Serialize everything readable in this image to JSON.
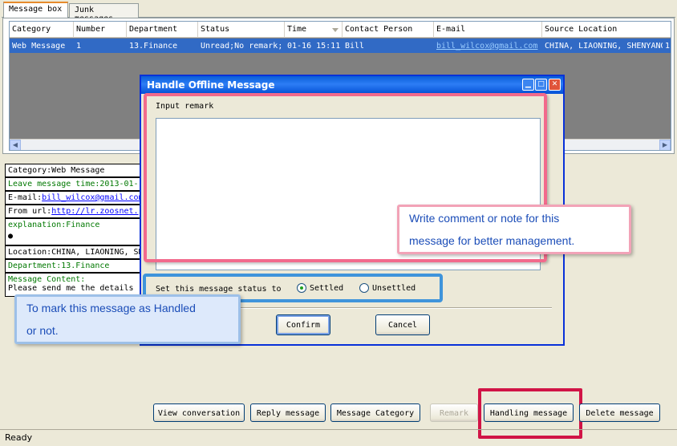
{
  "tabs": [
    {
      "label": "Message box",
      "active": true
    },
    {
      "label": "Junk messages",
      "active": false
    }
  ],
  "table": {
    "columns": [
      "Category",
      "Number",
      "Department",
      "Status",
      "Time",
      "Contact Person",
      "E-mail",
      "Source Location"
    ],
    "rows": [
      [
        "Web Message",
        "1",
        "13.Finance",
        "Unread;No remark;",
        "01-16 15:11",
        "Bill",
        "bill_wilcox@gmail.com",
        "CHINA, LIAONING, SHENYANG",
        "1"
      ]
    ]
  },
  "details": {
    "category": "Category:Web Message",
    "leave_time": "Leave message time:2013-01-",
    "email_prefix": "E-mail:",
    "email_value": "bill_wilcox@gmail.com",
    "from_url_prefix": "From url:",
    "from_url_value": "http://lr.zoosnet.",
    "explanation": "explanation:Finance",
    "bullet": "●",
    "location": "Location:CHINA, LIAONING, SHE",
    "department": "Department:13.Finance",
    "content_label": "Message Content:",
    "content_text": "Please send me the details"
  },
  "dialog": {
    "title": "Handle Offline Message",
    "remark_label": "Input remark",
    "remark_value": "",
    "status_label": "Set this message status to",
    "option_settled": "Settled",
    "option_unsettled": "Unsettled",
    "selected": "Settled",
    "confirm": "Confirm",
    "cancel": "Cancel"
  },
  "callouts": {
    "remark_note": [
      "Write comment or note for this",
      "message for better management."
    ],
    "status_note": [
      "To mark this message as Handled",
      "or not."
    ]
  },
  "toolbar": {
    "view_conversation": "View conversation",
    "reply_message": "Reply message",
    "message_category": "Message Category",
    "remark": "Remark",
    "handling_message": "Handling message",
    "delete_message": "Delete message"
  },
  "status": "Ready",
  "colors": {
    "selection": "#316ac5",
    "title_bar": "#0a5fd8",
    "highlight_pink": "#f26a8c",
    "highlight_blue": "#3f94db",
    "highlight_red": "#d11446"
  }
}
